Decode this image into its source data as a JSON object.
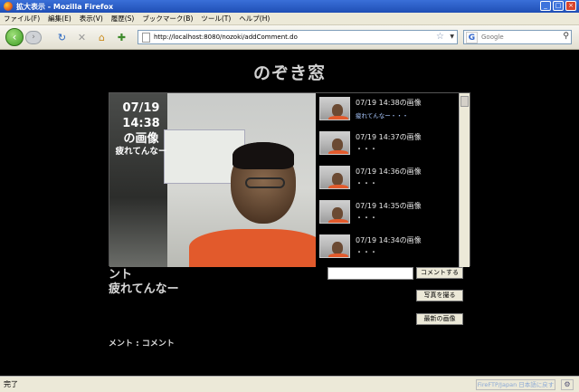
{
  "window": {
    "title": "拡大表示 - Mozilla Firefox",
    "buttons": {
      "minimize": "_",
      "maximize": "□",
      "close": "×"
    }
  },
  "menu": [
    "ファイル(F)",
    "編集(E)",
    "表示(V)",
    "履歴(S)",
    "ブックマーク(B)",
    "ツール(T)",
    "ヘルプ(H)"
  ],
  "toolbar": {
    "url": "http://localhost:8080/nozoki/addComment.do",
    "search_placeholder": "Google",
    "search_engine_letter": "G"
  },
  "page": {
    "title": "のぞき窓",
    "overlay": {
      "date": "07/19",
      "time": "14:38",
      "label": "の画像",
      "comment": "疲れてんなー"
    },
    "thumbnails": [
      {
        "label": "07/19 14:38の画像",
        "sub": "疲れてんなー・・・",
        "has_comment": true
      },
      {
        "label": "07/19 14:37の画像",
        "sub": "・・・",
        "has_comment": false
      },
      {
        "label": "07/19 14:36の画像",
        "sub": "・・・",
        "has_comment": false
      },
      {
        "label": "07/19 14:35の画像",
        "sub": "・・・",
        "has_comment": false
      },
      {
        "label": "07/19 14:34の画像",
        "sub": "・・・",
        "has_comment": false
      }
    ],
    "comment_heading": "ント",
    "comment_text": "疲れてんなー",
    "comment_input_value": "",
    "buttons": {
      "comment": "コメントする",
      "photo": "写真を撮る",
      "latest": "最新の画像"
    },
    "comment_list_label": "メント : コメント"
  },
  "status": {
    "text": "完了",
    "right_label": "FireFTP/Japan 日本語に戻す"
  }
}
